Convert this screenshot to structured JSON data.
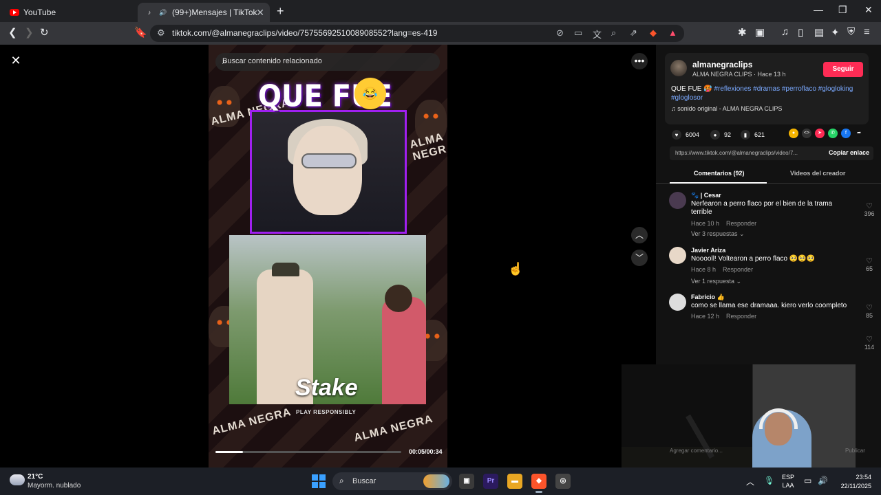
{
  "browser": {
    "tabs": [
      {
        "label": "YouTube",
        "favicon": "youtube-icon"
      },
      {
        "label": "(99+)Mensajes | TikTok",
        "favicon": "tiktok-icon"
      }
    ],
    "url": "tiktok.com/@almanegraclips/video/7575569251008908552?lang=es-419"
  },
  "video": {
    "search_placeholder": "Buscar contenido relacionado",
    "overlay_title": "QUE FUE",
    "sponsor": "Stake",
    "sponsor_sub": "PLAY RESPONSIBLY",
    "brand": "ALMA NEGRA",
    "time": "00:05/00:34",
    "progress_fraction": 0.147
  },
  "post": {
    "author": "almanegraclips",
    "author_sub": "ALMA NEGRA CLIPS · Hace 13 h",
    "follow_label": "Seguir",
    "caption": "QUE FUE",
    "tags": "#reflexiones #dramas #perroflaco #glogloking #glogloso r",
    "tags_display": "#reflexiones #dramas #perroflaco #glogloking #gloglosor",
    "sound": "sonido original - ALMA NEGRA CLIPS",
    "likes": "6004",
    "comments": "92",
    "saves": "621",
    "link": "https://www.tiktok.com/@almanegraclips/video/7...",
    "copy_label": "Copiar enlace",
    "tab_comments": "Comentarios (92)",
    "tab_videos": "Videos del creador"
  },
  "comments": [
    {
      "name": "Cesar",
      "text": "Nerfearon a perro flaco por el bien de la trama terrible",
      "time": "Hace 10 h",
      "reply": "Responder",
      "more": "Ver 3 respuestas",
      "likes": "396"
    },
    {
      "name": "Javier Ariza",
      "text": "Nooooll! Voltearon a perro flaco",
      "time": "Hace 8 h",
      "reply": "Responder",
      "more": "Ver 1 respuesta",
      "likes": "65"
    },
    {
      "name": "Fabricio",
      "text": "como se llama ese dramaaa. kiero verlo coompleto",
      "time": "Hace 12 h",
      "reply": "Responder",
      "more": "",
      "likes": "85"
    },
    {
      "name": "",
      "text": "",
      "time": "",
      "reply": "",
      "more": "",
      "likes": "114"
    }
  ],
  "comment_input": {
    "placeholder": "Agregar comentario...",
    "post_label": "Publicar"
  },
  "taskbar": {
    "temp": "21°C",
    "weather": "Mayorm. nublado",
    "search": "Buscar",
    "lang_1": "ESP",
    "lang_2": "LAA",
    "time": "23:54",
    "date": "22/11/2025"
  },
  "colors": {
    "follow": "#fe2c55",
    "tag": "#7aa9ff",
    "accent": "#a020f0"
  }
}
